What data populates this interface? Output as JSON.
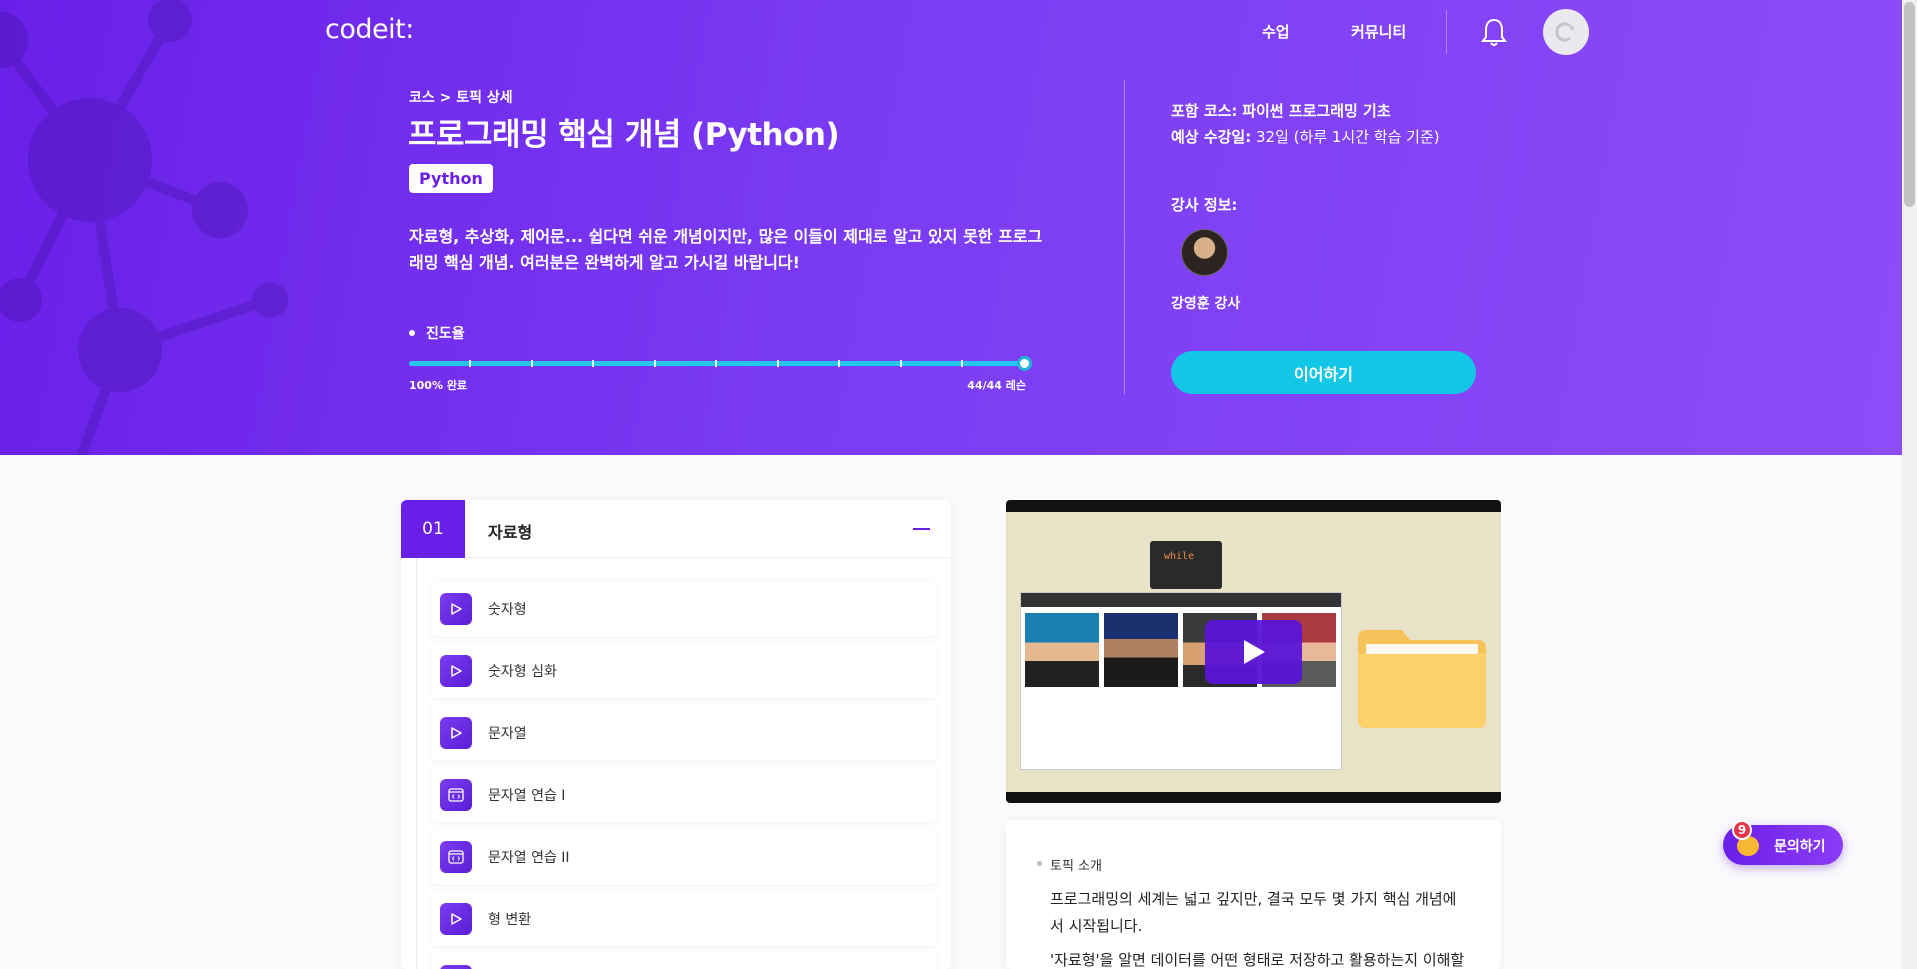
{
  "brand": {
    "logo_text": "codeit:"
  },
  "nav": {
    "items": [
      {
        "label": "수업"
      },
      {
        "label": "커뮤니티"
      }
    ]
  },
  "hero": {
    "breadcrumb": "코스 > 토픽 상세",
    "title": "프로그래밍 핵심 개념 (Python)",
    "tag": "Python",
    "description": "자료형, 추상화, 제어문... 쉽다면 쉬운 개념이지만, 많은 이들이 제대로 알고 있지 못한 프로그래밍 핵심 개념. 여러분은 완벽하게 알고 가시길 바랍니다!",
    "progress": {
      "label": "진도율",
      "fraction": 1.0,
      "done_text": "100% 완료",
      "count_text": "44/44 레슨"
    },
    "course_label": "포함 코스:",
    "course_value": "파이썬 프로그래밍 기초",
    "duration_label": "예상 수강일:",
    "duration_value": "32일 (하루 1시간 학습 기준)",
    "instructor_label": "강사 정보:",
    "instructor_name": "강영훈 강사",
    "continue_label": "이어하기"
  },
  "chapter": {
    "number": "01",
    "title": "자료형",
    "lessons": [
      {
        "label": "숫자형",
        "icon": "play-icon"
      },
      {
        "label": "숫자형 심화",
        "icon": "play-icon"
      },
      {
        "label": "문자열",
        "icon": "play-icon"
      },
      {
        "label": "문자열 연습 I",
        "icon": "code-icon"
      },
      {
        "label": "문자열 연습 II",
        "icon": "code-icon"
      },
      {
        "label": "형 변환",
        "icon": "play-icon"
      }
    ]
  },
  "video": {
    "code_line": "while"
  },
  "intro": {
    "label": "토픽 소개",
    "paragraph1": "프로그래밍의 세계는 넓고 깊지만, 결국 모두 몇 가지 핵심 개념에서 시작됩니다.",
    "paragraph2": "'자료형'을 알면 데이터를 어떤 형태로 저장하고 활용하는지 이해할"
  },
  "help": {
    "label": "문의하기",
    "badge": "9"
  },
  "colors": {
    "primary": "#6a1fe8",
    "accent": "#12c6e6",
    "progress": "#25c6ee"
  }
}
